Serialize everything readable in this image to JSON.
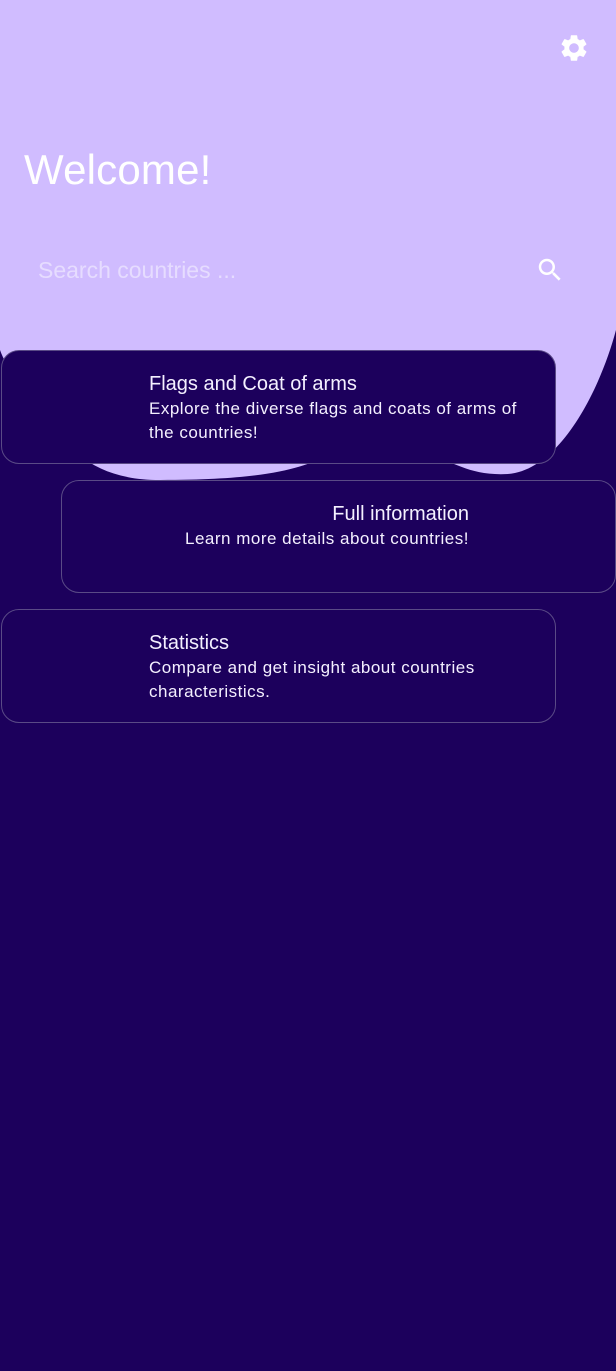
{
  "colors": {
    "background": "#1c005c",
    "header_blob": "#d0bcff",
    "card_border": "#5a4a86",
    "text": "#ffffff"
  },
  "header": {
    "title": "Welcome!",
    "settings_icon": "gear-icon"
  },
  "search": {
    "placeholder": "Search countries ...",
    "value": "",
    "icon": "search-icon"
  },
  "cards": [
    {
      "title": "Flags and Coat of arms",
      "description": "Explore the diverse flags and coats of arms of the countries!"
    },
    {
      "title": "Full information",
      "description": "Learn more details about countries!"
    },
    {
      "title": "Statistics",
      "description": "Compare and get insight about countries characteristics."
    }
  ]
}
